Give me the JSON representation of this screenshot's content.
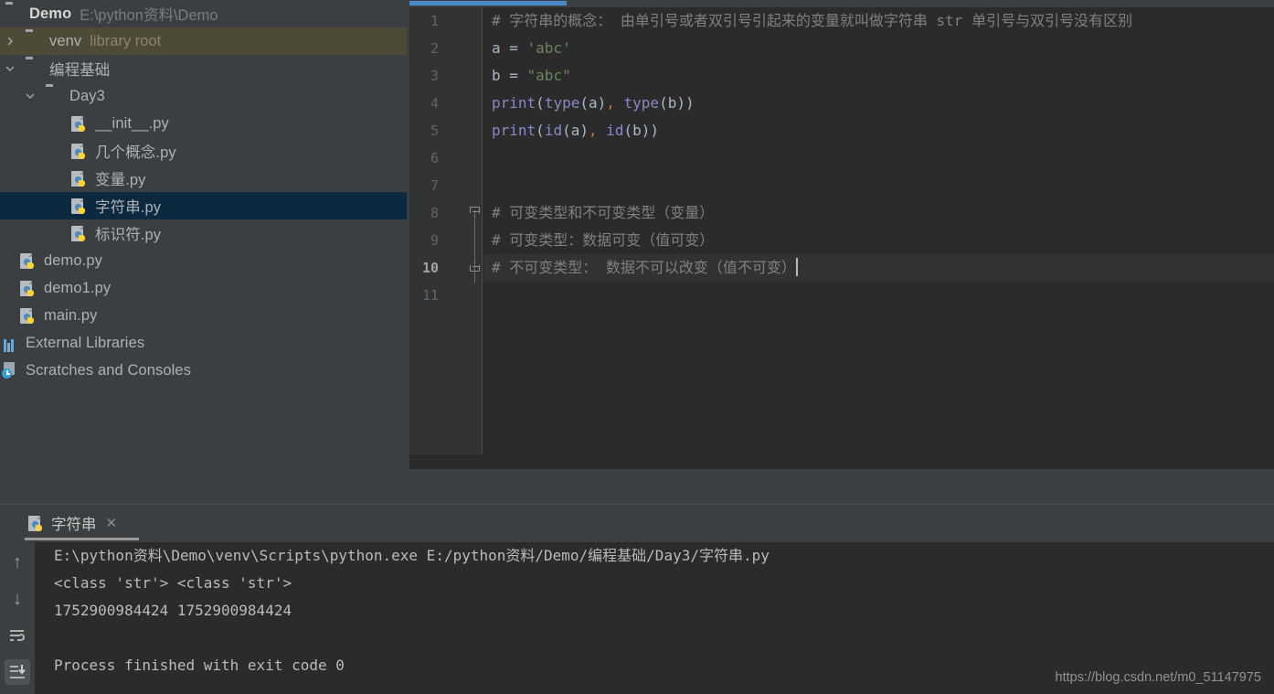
{
  "project_tree": {
    "rows": [
      {
        "label": "Demo",
        "sub": "E:\\python资料\\Demo",
        "icon": "folder-icon",
        "indent": 6,
        "chevron": "none",
        "bold": true,
        "state": "normal",
        "name": "tree-item-demo"
      },
      {
        "label": "venv",
        "sub": "library root",
        "icon": "folder-icon",
        "indent": 28,
        "chevron": "right",
        "bold": false,
        "state": "hover",
        "name": "tree-item-venv"
      },
      {
        "label": "编程基础",
        "sub": "",
        "icon": "folder-icon",
        "indent": 28,
        "chevron": "down",
        "bold": false,
        "state": "normal",
        "name": "tree-item-biancheng-jichu"
      },
      {
        "label": "Day3",
        "sub": "",
        "icon": "folder-src-icon",
        "indent": 50,
        "chevron": "down",
        "bold": false,
        "state": "normal",
        "name": "tree-item-day3"
      },
      {
        "label": "__init__.py",
        "sub": "",
        "icon": "python-file-icon",
        "indent": 78,
        "chevron": "none",
        "bold": false,
        "state": "normal",
        "name": "tree-item-init-py"
      },
      {
        "label": "几个概念.py",
        "sub": "",
        "icon": "python-file-icon",
        "indent": 78,
        "chevron": "none",
        "bold": false,
        "state": "normal",
        "name": "tree-item-jigegainian-py"
      },
      {
        "label": "变量.py",
        "sub": "",
        "icon": "python-file-icon",
        "indent": 78,
        "chevron": "none",
        "bold": false,
        "state": "normal",
        "name": "tree-item-bianliang-py"
      },
      {
        "label": "字符串.py",
        "sub": "",
        "icon": "python-file-icon",
        "indent": 78,
        "chevron": "none",
        "bold": false,
        "state": "selected",
        "name": "tree-item-zifuchuan-py"
      },
      {
        "label": "标识符.py",
        "sub": "",
        "icon": "python-file-icon",
        "indent": 78,
        "chevron": "none",
        "bold": false,
        "state": "normal",
        "name": "tree-item-biaoshifu-py"
      },
      {
        "label": "demo.py",
        "sub": "",
        "icon": "python-file-icon",
        "indent": 22,
        "chevron": "none",
        "bold": false,
        "state": "normal",
        "name": "tree-item-demo-py"
      },
      {
        "label": "demo1.py",
        "sub": "",
        "icon": "python-file-icon",
        "indent": 22,
        "chevron": "none",
        "bold": false,
        "state": "normal",
        "name": "tree-item-demo1-py"
      },
      {
        "label": "main.py",
        "sub": "",
        "icon": "python-file-icon",
        "indent": 22,
        "chevron": "none",
        "bold": false,
        "state": "normal",
        "name": "tree-item-main-py"
      },
      {
        "label": "External Libraries",
        "sub": "",
        "icon": "external-libraries-icon",
        "indent": 2,
        "chevron": "right",
        "bold": false,
        "state": "normal",
        "name": "tree-item-external-libraries"
      },
      {
        "label": "Scratches and Consoles",
        "sub": "",
        "icon": "scratches-icon",
        "indent": 2,
        "chevron": "right",
        "bold": false,
        "state": "normal",
        "name": "tree-item-scratches-and-consoles"
      }
    ]
  },
  "editor": {
    "lines": [
      {
        "num": "1",
        "tokens": [
          {
            "t": "comment",
            "v": "# 字符串的概念： 由单引号或者双引号引起来的变量就叫做字符串 str 单引号与双引号没有区别"
          }
        ]
      },
      {
        "num": "2",
        "tokens": [
          {
            "t": "ident",
            "v": "a "
          },
          {
            "t": "eq",
            "v": "= "
          },
          {
            "t": "str",
            "v": "'abc'"
          }
        ]
      },
      {
        "num": "3",
        "tokens": [
          {
            "t": "ident",
            "v": "b "
          },
          {
            "t": "eq",
            "v": "= "
          },
          {
            "t": "str",
            "v": "\"abc\""
          }
        ]
      },
      {
        "num": "4",
        "tokens": [
          {
            "t": "fn",
            "v": "print"
          },
          {
            "t": "punc",
            "v": "("
          },
          {
            "t": "builtin",
            "v": "type"
          },
          {
            "t": "punc",
            "v": "(a)"
          },
          {
            "t": "comma",
            "v": ","
          },
          {
            "t": "punc",
            "v": " "
          },
          {
            "t": "builtin",
            "v": "type"
          },
          {
            "t": "punc",
            "v": "(b))"
          }
        ]
      },
      {
        "num": "5",
        "tokens": [
          {
            "t": "fn",
            "v": "print"
          },
          {
            "t": "punc",
            "v": "("
          },
          {
            "t": "builtin",
            "v": "id"
          },
          {
            "t": "punc",
            "v": "(a)"
          },
          {
            "t": "comma",
            "v": ","
          },
          {
            "t": "punc",
            "v": " "
          },
          {
            "t": "builtin",
            "v": "id"
          },
          {
            "t": "punc",
            "v": "(b))"
          }
        ]
      },
      {
        "num": "6",
        "tokens": []
      },
      {
        "num": "7",
        "tokens": []
      },
      {
        "num": "8",
        "tokens": [
          {
            "t": "comment",
            "v": "# 可变类型和不可变类型（变量）"
          }
        ]
      },
      {
        "num": "9",
        "tokens": [
          {
            "t": "comment",
            "v": "# 可变类型：数据可变（值可变）"
          }
        ]
      },
      {
        "num": "10",
        "tokens": [
          {
            "t": "comment",
            "v": "# 不可变类型： 数据不可以改变（值不可变）"
          }
        ],
        "current": true,
        "caret": true
      },
      {
        "num": "11",
        "tokens": []
      }
    ]
  },
  "console": {
    "tab_label": "字符串",
    "tab_close_glyph": "✕",
    "toolbar": [
      {
        "name": "scroll-up-icon",
        "glyph": "↑",
        "active": false
      },
      {
        "name": "scroll-down-icon",
        "glyph": "↓",
        "active": false
      },
      {
        "name": "soft-wrap-icon",
        "glyph": "",
        "active": false
      },
      {
        "name": "scroll-to-end-icon",
        "glyph": "",
        "active": true
      }
    ],
    "output": [
      "E:\\python资料\\Demo\\venv\\Scripts\\python.exe E:/python资料/Demo/编程基础/Day3/字符串.py",
      "<class 'str'> <class 'str'>",
      "1752900984424 1752900984424",
      "",
      "Process finished with exit code 0"
    ]
  },
  "watermark": {
    "text": "https://blog.csdn.net/m0_51147975"
  },
  "colors": {
    "accent_blue": "#4a88c7",
    "editor_bg": "#2b2b2b",
    "panel_bg": "#3c3f41",
    "gutter_bg": "#313335",
    "selection_blue": "#0d293f",
    "hover_olive": "#4e4a38",
    "comment_gray": "#808080",
    "string_green": "#6a8759",
    "function_purple": "#8888c6",
    "text_main": "#a9b7c6",
    "comma_orange": "#cc7832"
  }
}
